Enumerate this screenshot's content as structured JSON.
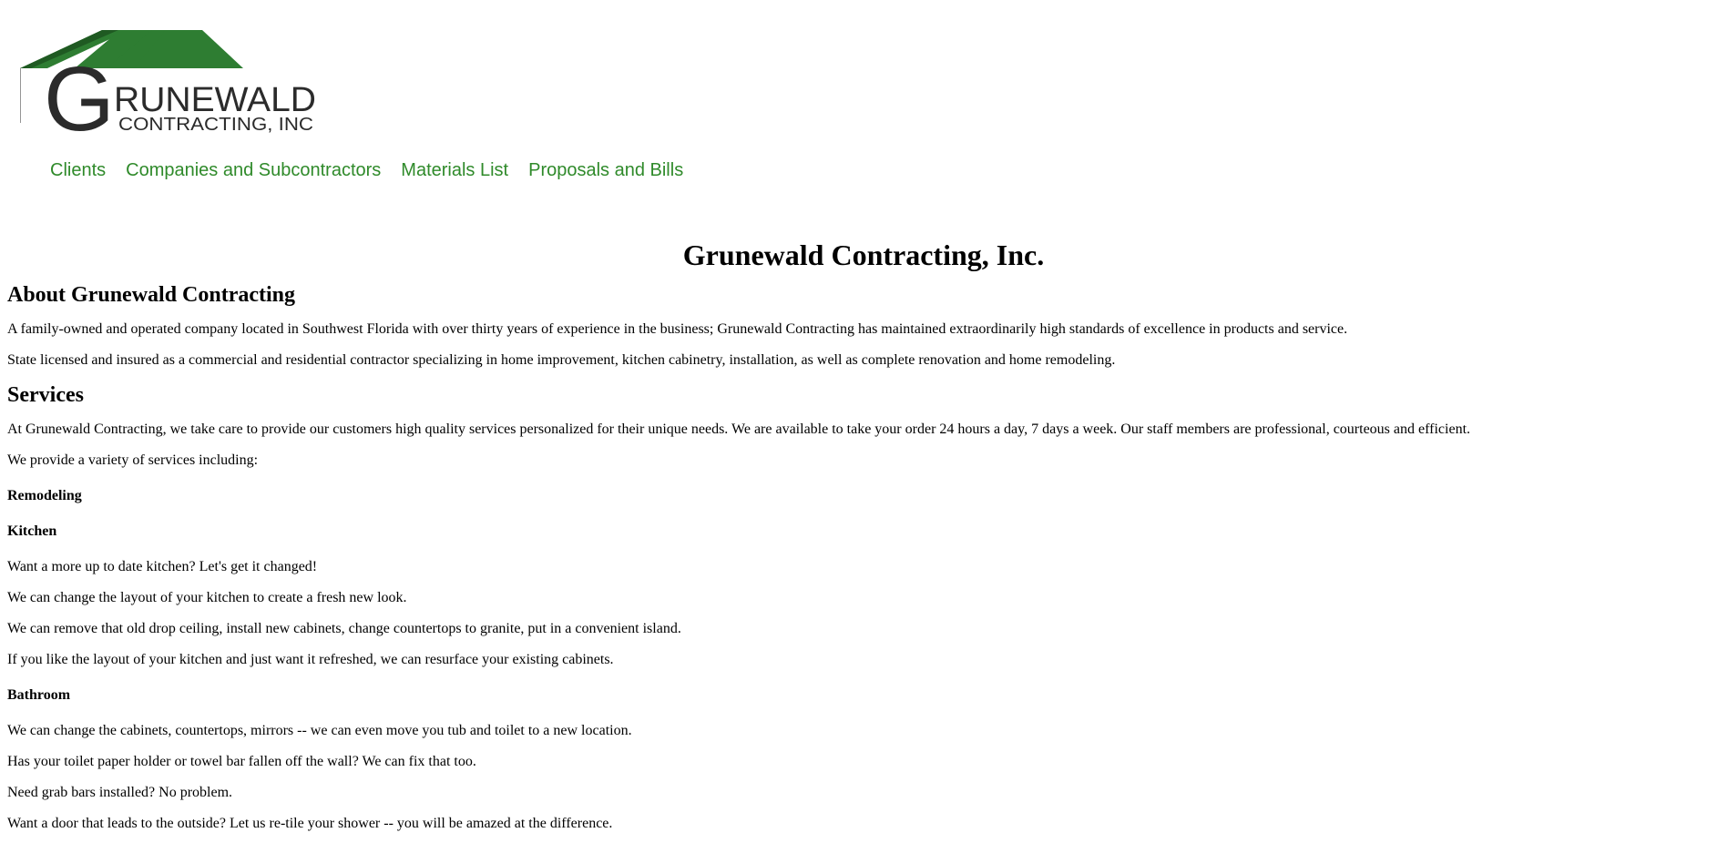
{
  "logo": {
    "letter": "G",
    "word_top": "RUNEWALD",
    "word_bottom": "CONTRACTING, INC"
  },
  "nav": {
    "items": [
      "Clients",
      "Companies and Subcontractors",
      "Materials List",
      "Proposals and Bills"
    ]
  },
  "colors": {
    "nav_link": "#2f8a2a",
    "logo_green": "#2e7d32",
    "logo_dark": "#2b2b2b"
  },
  "main": {
    "title": "Grunewald Contracting, Inc.",
    "about_heading": "About Grunewald Contracting",
    "about_p1": "A family-owned and operated company located in Southwest Florida with over thirty years of experience in the business; Grunewald Contracting has maintained extraordinarily high standards of excellence in products and service.",
    "about_p2": "State licensed and insured as a commercial and residential contractor specializing in home improvement, kitchen cabinetry, installation, as well as complete renovation and home remodeling.",
    "services_heading": "Services",
    "services_p1": "At Grunewald Contracting, we take care to provide our customers high quality services personalized for their unique needs. We are available to take your order 24 hours a day, 7 days a week. Our staff members are professional, courteous and efficient.",
    "services_p2": "We provide a variety of services including:",
    "remodeling_heading": "Remodeling",
    "kitchen_heading": "Kitchen",
    "kitchen_lines": [
      "Want a more up to date kitchen? Let's get it changed!",
      "We can change the layout of your kitchen to create a fresh new look.",
      "We can remove that old drop ceiling, install new cabinets, change countertops to granite, put in a convenient island.",
      "If you like the layout of your kitchen and just want it refreshed, we can resurface your existing cabinets."
    ],
    "bathroom_heading": "Bathroom",
    "bathroom_lines": [
      "We can change the cabinets, countertops, mirrors -- we can even move you tub and toilet to a new location.",
      "Has your toilet paper holder or towel bar fallen off the wall? We can fix that too.",
      "Need grab bars installed? No problem.",
      "Want a door that leads to the outside? Let us re-tile your shower -- you will be amazed at the difference."
    ]
  }
}
